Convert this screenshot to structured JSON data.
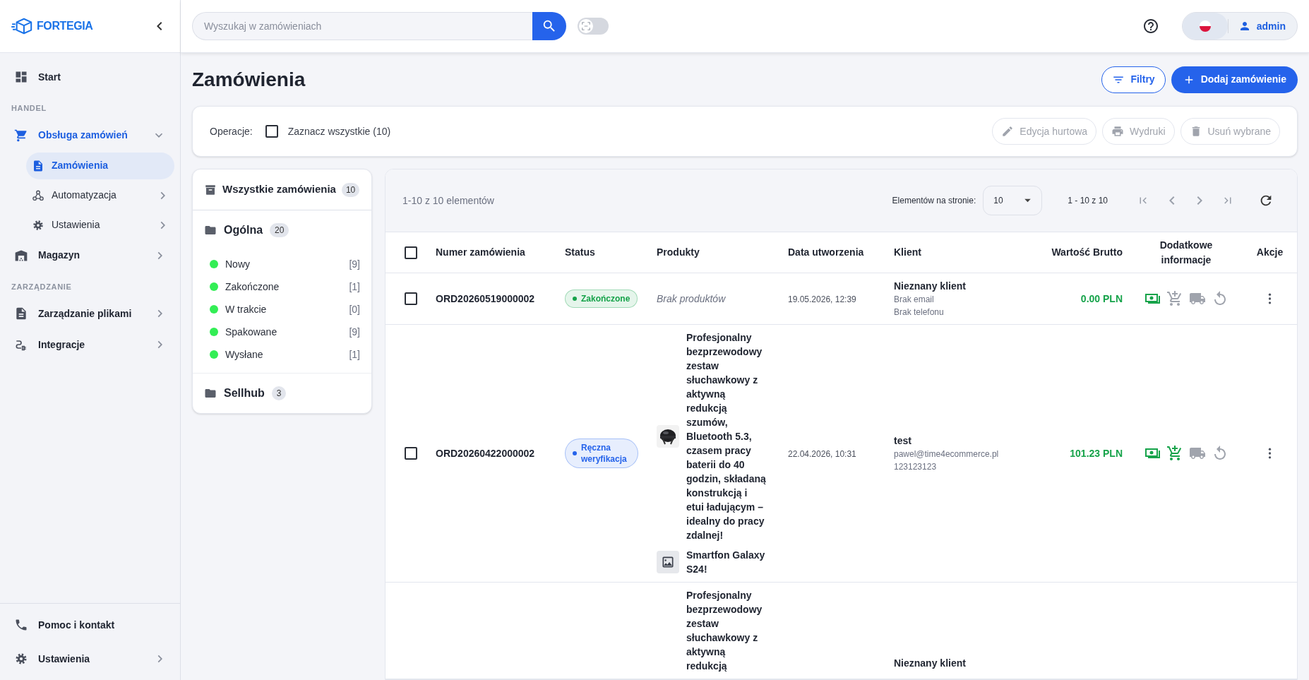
{
  "sidebar": {
    "logo": "FORTEGIA",
    "items": [
      {
        "kind": "link",
        "label": "Start",
        "selected": false
      },
      {
        "kind": "section",
        "label": "HANDEL"
      },
      {
        "kind": "link",
        "label": "Obsługa zamówień",
        "selected": true,
        "expanded": true,
        "children": [
          {
            "label": "Zamówienia",
            "selected": true
          },
          {
            "label": "Automatyzacja",
            "selected": false,
            "expanded": false
          },
          {
            "label": "Ustawienia",
            "selected": false,
            "expanded": false
          }
        ]
      },
      {
        "kind": "link",
        "label": "Magazyn",
        "selected": false,
        "expanded": false
      },
      {
        "kind": "section",
        "label": "ZARZĄDZANIE"
      },
      {
        "kind": "link",
        "label": "Zarządzanie plikami",
        "selected": false,
        "expanded": false
      },
      {
        "kind": "link",
        "label": "Integracje",
        "selected": false,
        "expanded": false
      }
    ],
    "footer": [
      {
        "label": "Pomoc i kontakt"
      },
      {
        "label": "Ustawienia",
        "expanded": false
      }
    ]
  },
  "topbar": {
    "search": {
      "placeholder": "Wyszukaj w zamówieniach"
    },
    "scanner_toggle": {
      "on": false
    },
    "user": {
      "name": "admin"
    }
  },
  "page": {
    "title": "Zamówienia",
    "actions": [
      {
        "kind": "outline",
        "label": "Filtry"
      },
      {
        "kind": "primary",
        "label": "Dodaj zamówienie"
      }
    ]
  },
  "operations": {
    "label": "Operacje:",
    "select_all": {
      "label": "Zaznacz wszystkie (10)",
      "checked": false
    },
    "buttons": [
      {
        "label": "Edycja hurtowa",
        "disabled": true
      },
      {
        "label": "Wydruki",
        "disabled": true
      },
      {
        "label": "Usuń wybrane",
        "disabled": true
      }
    ]
  },
  "filters": {
    "all": {
      "label": "Wszystkie zamówienia",
      "count": "10"
    },
    "groups": [
      {
        "label": "Ogólna",
        "count": "20",
        "statuses": [
          {
            "label": "Nowy",
            "count": "[9]",
            "color": "#33ee55"
          },
          {
            "label": "Zakończone",
            "count": "[1]",
            "color": "#33ee55"
          },
          {
            "label": "W trakcie",
            "count": "[0]",
            "color": "#33ee55"
          },
          {
            "label": "Spakowane",
            "count": "[9]",
            "color": "#33ee55"
          },
          {
            "label": "Wysłane",
            "count": "[1]",
            "color": "#33ee55"
          }
        ]
      },
      {
        "label": "Sellhub",
        "count": "3"
      }
    ]
  },
  "table": {
    "summary": "1-10 z 10 elementów",
    "per_page_label": "Elementów na stronie:",
    "per_page": "10",
    "range": "1 - 10 z 10",
    "header_checkbox": {
      "checked": false
    },
    "columns": [
      "Numer zamówienia",
      "Status",
      "Produkty",
      "Data utworzenia",
      "Klient",
      "Wartość Brutto",
      "Dodatkowe informacje",
      "Akcje"
    ],
    "rows": [
      {
        "checked": false,
        "number": "ORD20260519000002",
        "status": {
          "label": "Zakończone",
          "color": "#16a34a"
        },
        "no_products": "Brak produktów",
        "date": "19.05.2026, 12:39",
        "client": {
          "name": "Nieznany klient",
          "lines": [
            "Brak email",
            "Brak telefonu"
          ]
        },
        "value": "0.00 PLN",
        "info": [
          {
            "active": true
          },
          {
            "active": false
          },
          {
            "active": false
          },
          {
            "active": false
          }
        ]
      },
      {
        "checked": false,
        "number": "ORD20260422000002",
        "status": {
          "label": "Ręczna weryfikacja",
          "color": "#2563eb"
        },
        "products": [
          {
            "name": "Profesjonalny bezprzewodowy zestaw słuchawkowy z aktywną redukcją szumów, Bluetooth 5.3, czasem pracy baterii do 40 godzin, składaną konstrukcją i etui ładującym – idealny do pracy zdalnej!"
          },
          {
            "kind": "placeholder",
            "name": "Smartfon Galaxy S24!"
          }
        ],
        "date": "22.04.2026, 10:31",
        "client": {
          "name": "test",
          "lines": [
            "pawel@time4ecommerce.pl",
            "123123123"
          ]
        },
        "value": "101.23 PLN",
        "info": [
          {
            "active": true
          },
          {
            "active": true
          },
          {
            "active": false
          },
          {
            "active": false
          }
        ]
      },
      {
        "products": [
          {
            "name": "Profesjonalny bezprzewodowy zestaw słuchawkowy z aktywną redukcją"
          }
        ],
        "client": {
          "name": "Nieznany klient"
        }
      }
    ]
  }
}
